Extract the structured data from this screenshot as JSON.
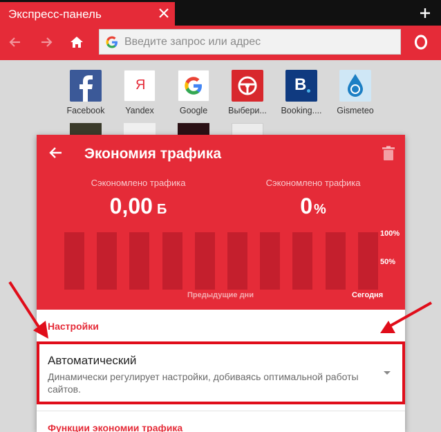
{
  "colors": {
    "accent": "#e52b38",
    "bar": "#c41f2d",
    "highlight": "#e00d1a"
  },
  "tab": {
    "title": "Экспресс-панель",
    "close_icon": "close-icon"
  },
  "toolbar": {
    "back_icon": "back-arrow-icon",
    "forward_icon": "forward-arrow-icon",
    "home_icon": "home-icon",
    "search_placeholder": "Введите запрос или адрес",
    "menu_icon": "opera-logo-icon"
  },
  "speed_dial": {
    "tiles": [
      {
        "label": "Facebook",
        "icon": "facebook-icon"
      },
      {
        "label": "Yandex",
        "icon": "yandex-icon"
      },
      {
        "label": "Google",
        "icon": "google-icon"
      },
      {
        "label": "Выбери...",
        "icon": "steering-wheel-icon"
      },
      {
        "label": "Booking....",
        "icon": "booking-icon"
      },
      {
        "label": "Gismeteo",
        "icon": "gismeteo-icon"
      }
    ]
  },
  "traffic_savings": {
    "title": "Экономия трафика",
    "saved_bytes_label": "Сэкономлено трафика",
    "saved_bytes_value": "0,00",
    "saved_bytes_unit": "Б",
    "saved_percent_label": "Сэкономлено трафика",
    "saved_percent_value": "0",
    "saved_percent_unit": "%",
    "chart_pct_high": "100%",
    "chart_pct_mid": "50%",
    "chart_previous_days": "Предыдущие дни",
    "chart_today": "Сегодня",
    "settings_title": "Настройки",
    "mode_title": "Автоматический",
    "mode_description": "Динамически регулирует настройки, добиваясь оптимальной работы сайтов.",
    "features_title": "Функции экономии трафика"
  },
  "chart_data": {
    "type": "bar",
    "categories": [
      "",
      "",
      "",
      "",
      "",
      "",
      "",
      "",
      "",
      ""
    ],
    "values": [
      0,
      0,
      0,
      0,
      0,
      0,
      0,
      0,
      0,
      0
    ],
    "xlabel": "Предыдущие дни",
    "today_label": "Сегодня",
    "ylim": [
      0,
      100
    ],
    "yticks": [
      "50%",
      "100%"
    ]
  }
}
